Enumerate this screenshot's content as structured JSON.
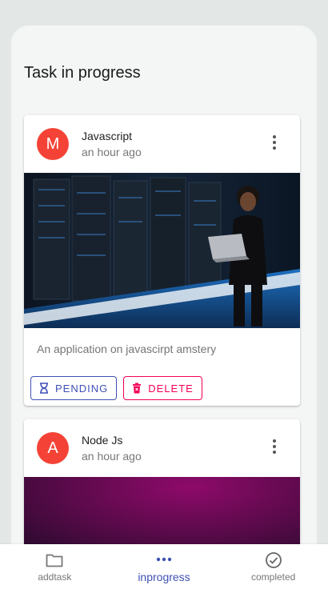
{
  "panel": {
    "title": "Task in progress"
  },
  "tasks": [
    {
      "avatar_letter": "M",
      "title": "Javascript",
      "time": "an hour ago",
      "description": "An application on javascirpt amstery",
      "pending_label": "PENDING",
      "delete_label": "DELETE",
      "image": "server-room-woman-laptop"
    },
    {
      "avatar_letter": "A",
      "title": "Node Js",
      "time": "an hour ago",
      "image": "purple-gradient"
    }
  ],
  "bottom_nav": {
    "items": [
      {
        "label": "addtask",
        "icon": "folder-icon",
        "active": false
      },
      {
        "label": "inprogress",
        "icon": "more-horizontal-icon",
        "active": true
      },
      {
        "label": "completed",
        "icon": "check-circle-icon",
        "active": false
      }
    ]
  },
  "colors": {
    "background": "#e3e7e6",
    "panel": "#f4f6f5",
    "avatar": "#f44336",
    "primary": "#3f51b5",
    "secondary": "#f50057"
  }
}
